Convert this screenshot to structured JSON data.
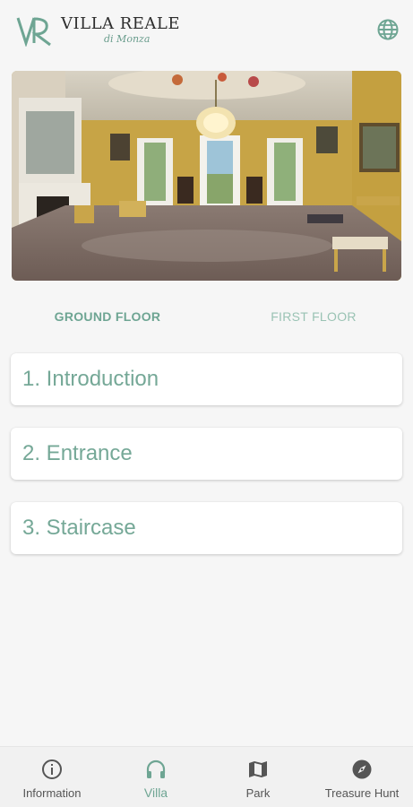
{
  "header": {
    "logo_title": "VILLA REALE",
    "logo_subtitle": "di Monza",
    "globe_icon": "globe-icon"
  },
  "hero": {
    "image": "villa-interior-hall-photo"
  },
  "tabs": [
    {
      "label": "GROUND FLOOR",
      "active": true
    },
    {
      "label": "FIRST FLOOR",
      "active": false
    }
  ],
  "rooms": [
    {
      "label": "1. Introduction"
    },
    {
      "label": "2. Entrance"
    },
    {
      "label": "3. Staircase"
    }
  ],
  "bottom_nav": [
    {
      "label": "Information",
      "icon": "info-icon",
      "active": false
    },
    {
      "label": "Villa",
      "icon": "headphones-icon",
      "active": true
    },
    {
      "label": "Park",
      "icon": "map-icon",
      "active": false
    },
    {
      "label": "Treasure Hunt",
      "icon": "compass-icon",
      "active": false
    }
  ],
  "colors": {
    "accent": "#6ea593",
    "accent_light": "#9ac3b4",
    "background": "#f6f6f6"
  }
}
